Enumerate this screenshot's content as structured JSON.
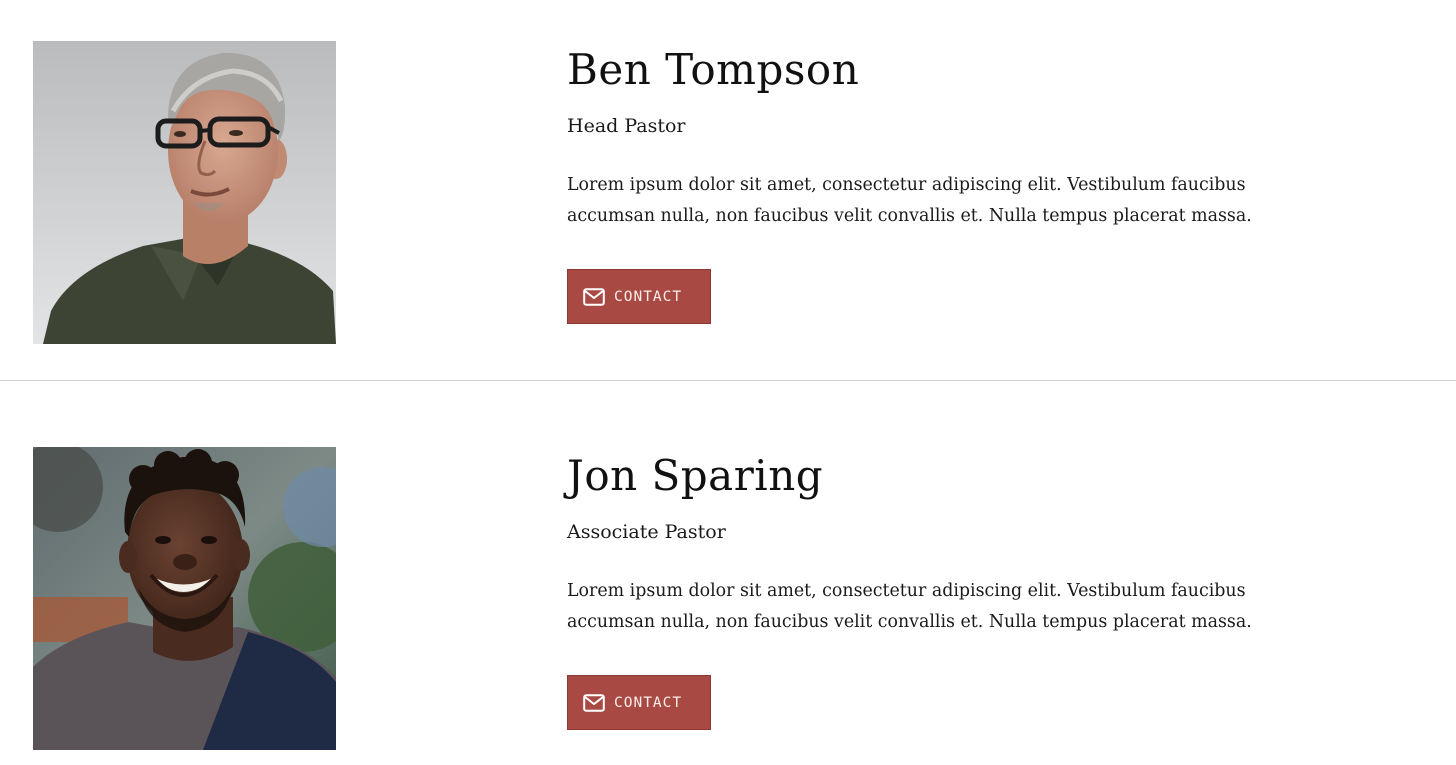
{
  "staff": [
    {
      "name": "Ben Tompson",
      "role": "Head Pastor",
      "bio": "Lorem ipsum dolor sit amet, consectetur adipiscing elit. Vestibulum faucibus accumsan nulla, non faucibus velit convallis et. Nulla tempus placerat massa.",
      "contact_label": "CONTACT",
      "photo_icon": "portrait-photo",
      "button_icon": "envelope-icon"
    },
    {
      "name": "Jon Sparing",
      "role": "Associate Pastor",
      "bio": "Lorem ipsum dolor sit amet, consectetur adipiscing elit. Vestibulum faucibus accumsan nulla, non faucibus velit convallis et. Nulla tempus placerat massa.",
      "contact_label": "CONTACT",
      "photo_icon": "portrait-photo",
      "button_icon": "envelope-icon"
    }
  ],
  "colors": {
    "button_bg": "#a84a43",
    "button_text": "#fbeeed",
    "divider": "#cfcfcf",
    "text": "#111111"
  }
}
